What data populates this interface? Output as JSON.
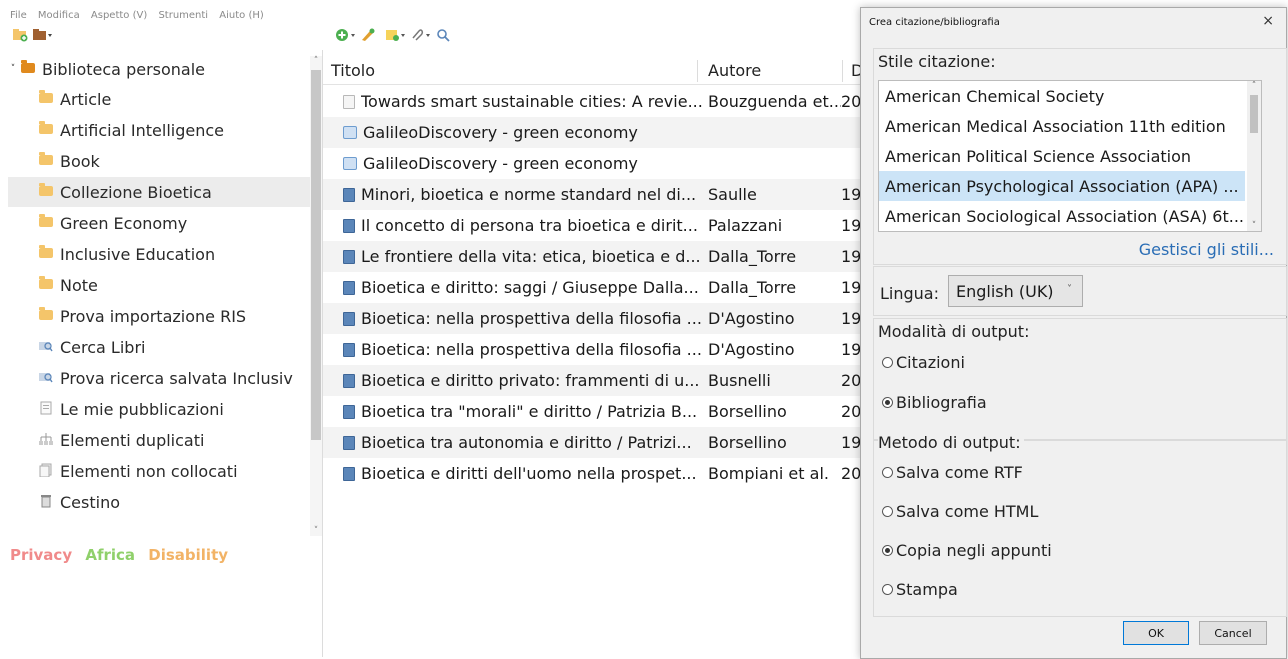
{
  "menubar": {
    "file": "File",
    "edit": "Modifica",
    "view": "Aspetto (V)",
    "tools": "Strumenti",
    "help": "Aiuto (H)"
  },
  "toolbar": {
    "new_collection_icon": "new-collection-icon",
    "new_library_icon": "library-menu-icon",
    "chev": "▾"
  },
  "sidebar": {
    "library": "Biblioteca personale",
    "items": [
      {
        "label": "Article",
        "icon": "folder"
      },
      {
        "label": "Artificial Intelligence",
        "icon": "folder"
      },
      {
        "label": "Book",
        "icon": "folder"
      },
      {
        "label": "Collezione Bioetica",
        "icon": "folder",
        "selected": true
      },
      {
        "label": "Green Economy",
        "icon": "folder"
      },
      {
        "label": "Inclusive Education",
        "icon": "folder"
      },
      {
        "label": "Note",
        "icon": "folder"
      },
      {
        "label": "Prova importazione RIS",
        "icon": "folder"
      },
      {
        "label": "Cerca Libri",
        "icon": "saved-search"
      },
      {
        "label": "Prova ricerca salvata Inclusiv",
        "icon": "saved-search"
      },
      {
        "label": "Le mie pubblicazioni",
        "icon": "publications"
      },
      {
        "label": "Elementi duplicati",
        "icon": "duplicates"
      },
      {
        "label": "Elementi non collocati",
        "icon": "unfiled"
      },
      {
        "label": "Cestino",
        "icon": "trash"
      }
    ]
  },
  "tags": [
    {
      "label": "Privacy",
      "color": "#f08a8a"
    },
    {
      "label": "Africa",
      "color": "#8fd06a"
    },
    {
      "label": "Disability",
      "color": "#f2b366"
    }
  ],
  "items_table": {
    "columns": {
      "title": "Titolo",
      "author": "Autore",
      "date": "D"
    },
    "rows": [
      {
        "type": "doc",
        "title": "Towards smart sustainable cities: A revie...",
        "author": "Bouzguenda et...",
        "date": "20"
      },
      {
        "type": "web",
        "title": "GalileoDiscovery - green economy",
        "author": "",
        "date": ""
      },
      {
        "type": "web",
        "title": "GalileoDiscovery - green economy",
        "author": "",
        "date": ""
      },
      {
        "type": "book",
        "title": "Minori, bioetica e norme standard nel di...",
        "author": "Saulle",
        "date": "19"
      },
      {
        "type": "book",
        "title": "Il concetto di persona tra bioetica e dirit...",
        "author": "Palazzani",
        "date": "19"
      },
      {
        "type": "book",
        "title": "Le frontiere della vita: etica, bioetica e d...",
        "author": "Dalla_Torre",
        "date": "19"
      },
      {
        "type": "book",
        "title": "Bioetica e diritto: saggi / Giuseppe Dalla...",
        "author": "Dalla_Torre",
        "date": "19"
      },
      {
        "type": "book",
        "title": "Bioetica: nella prospettiva della filosofia ...",
        "author": "D'Agostino",
        "date": "19"
      },
      {
        "type": "book",
        "title": "Bioetica: nella prospettiva della filosofia ...",
        "author": "D'Agostino",
        "date": "19"
      },
      {
        "type": "book",
        "title": "Bioetica e diritto privato: frammenti di u...",
        "author": "Busnelli",
        "date": "20"
      },
      {
        "type": "book",
        "title": "Bioetica tra \"morali\" e diritto / Patrizia B...",
        "author": "Borsellino",
        "date": "20"
      },
      {
        "type": "book",
        "title": "Bioetica tra autonomia e diritto / Patrizi...",
        "author": "Borsellino",
        "date": "19"
      },
      {
        "type": "book",
        "title": "Bioetica e diritti dell'uomo nella prospet...",
        "author": "Bompiani et al.",
        "date": "20"
      }
    ]
  },
  "dialog": {
    "title": "Crea citazione/bibliografia",
    "close": "×",
    "style_label": "Stile citazione:",
    "styles": [
      {
        "label": "American Chemical Society"
      },
      {
        "label": "American Medical Association 11th edition"
      },
      {
        "label": "American Political Science Association"
      },
      {
        "label": "American Psychological Association (APA) ...",
        "selected": true
      },
      {
        "label": "American Sociological Association (ASA) 6t..."
      }
    ],
    "manage_styles": "Gestisci gli stili...",
    "language_label": "Lingua:",
    "language_value": "English (UK)",
    "output_mode_label": "Modalità di output:",
    "output_modes": [
      {
        "label": "Citazioni",
        "checked": false
      },
      {
        "label": "Bibliografia",
        "checked": true
      }
    ],
    "output_method_label": "Metodo di output:",
    "output_methods": [
      {
        "label": "Salva come RTF",
        "checked": false
      },
      {
        "label": "Salva come HTML",
        "checked": false
      },
      {
        "label": "Copia negli appunti",
        "checked": true
      },
      {
        "label": "Stampa",
        "checked": false
      }
    ],
    "ok": "OK",
    "cancel": "Cancel"
  }
}
